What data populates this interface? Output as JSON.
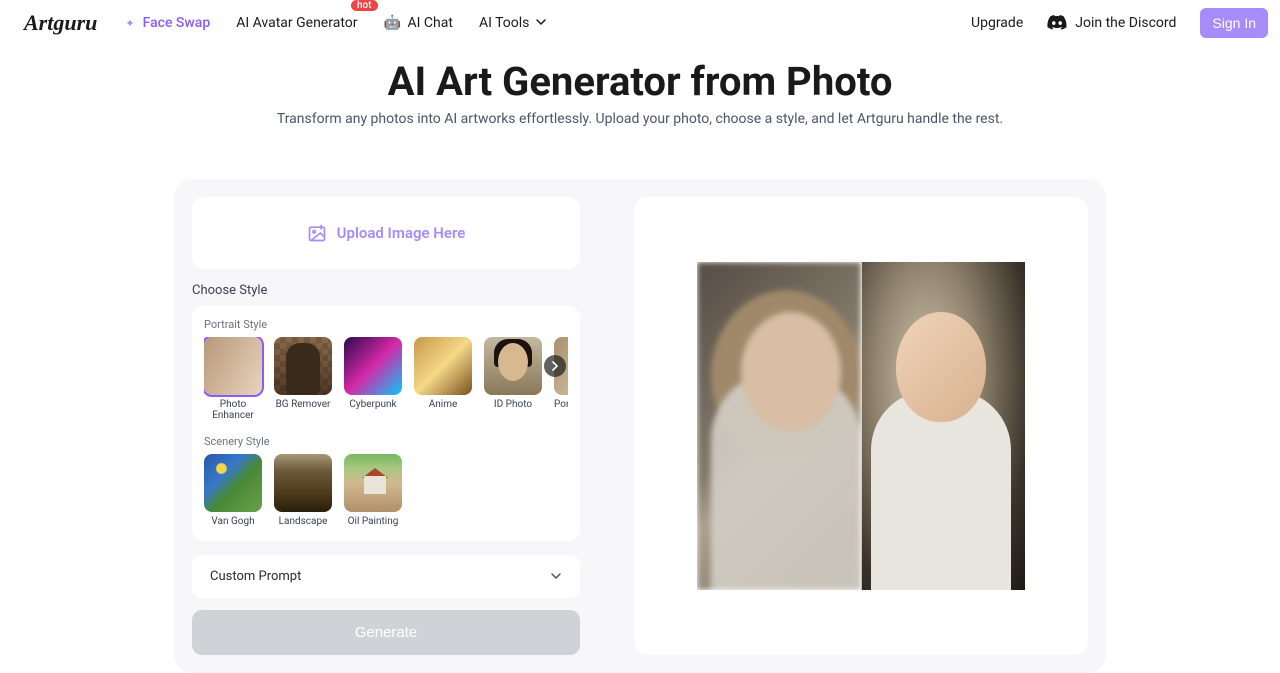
{
  "brand": "Artguru",
  "nav": {
    "face_swap": "Face Swap",
    "avatar_generator": "AI Avatar Generator",
    "hot_badge": "hot",
    "ai_chat": "AI Chat",
    "ai_tools": "AI Tools",
    "upgrade": "Upgrade",
    "discord": "Join the Discord",
    "sign_in": "Sign In"
  },
  "hero": {
    "title": "AI Art Generator from Photo",
    "subtitle": "Transform any photos into AI artworks effortlessly. Upload your photo, choose a style, and let Artguru handle the rest."
  },
  "upload": {
    "label": "Upload Image Here"
  },
  "styles": {
    "choose_label": "Choose Style",
    "portrait_label": "Portrait Style",
    "scenery_label": "Scenery Style",
    "portrait": [
      {
        "label": "Photo Enhancer"
      },
      {
        "label": "BG Remover"
      },
      {
        "label": "Cyberpunk"
      },
      {
        "label": "Anime"
      },
      {
        "label": "ID Photo"
      },
      {
        "label": "Portrait"
      }
    ],
    "scenery": [
      {
        "label": "Van Gogh"
      },
      {
        "label": "Landscape"
      },
      {
        "label": "Oil Painting"
      }
    ]
  },
  "custom_prompt_label": "Custom Prompt",
  "generate_label": "Generate"
}
